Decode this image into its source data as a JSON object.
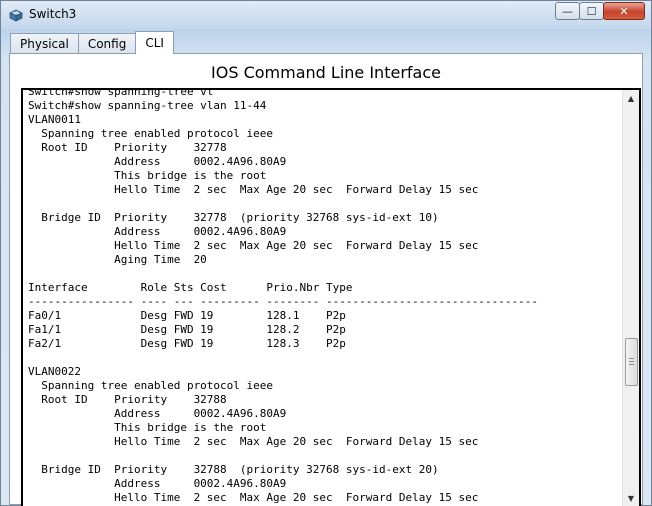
{
  "window": {
    "title": "Switch3",
    "app_icon": "cisco-switch-icon",
    "minimize_icon": "—",
    "maximize_icon": "☐",
    "close_icon": "✕"
  },
  "tabs": [
    {
      "label": "Physical",
      "active": false
    },
    {
      "label": "Config",
      "active": false
    },
    {
      "label": "CLI",
      "active": true
    }
  ],
  "cli": {
    "heading": "IOS Command Line Interface",
    "lines": [
      "Switch#show spanning-tree vl",
      "Switch#show spanning-tree vlan 11-44",
      "VLAN0011",
      "  Spanning tree enabled protocol ieee",
      "  Root ID    Priority    32778",
      "             Address     0002.4A96.80A9",
      "             This bridge is the root",
      "             Hello Time  2 sec  Max Age 20 sec  Forward Delay 15 sec",
      "",
      "  Bridge ID  Priority    32778  (priority 32768 sys-id-ext 10)",
      "             Address     0002.4A96.80A9",
      "             Hello Time  2 sec  Max Age 20 sec  Forward Delay 15 sec",
      "             Aging Time  20",
      "",
      "Interface        Role Sts Cost      Prio.Nbr Type",
      "---------------- ---- --- --------- -------- --------------------------------",
      "Fa0/1            Desg FWD 19        128.1    P2p",
      "Fa1/1            Desg FWD 19        128.2    P2p",
      "Fa2/1            Desg FWD 19        128.3    P2p",
      "",
      "VLAN0022",
      "  Spanning tree enabled protocol ieee",
      "  Root ID    Priority    32788",
      "             Address     0002.4A96.80A9",
      "             This bridge is the root",
      "             Hello Time  2 sec  Max Age 20 sec  Forward Delay 15 sec",
      "",
      "  Bridge ID  Priority    32788  (priority 32768 sys-id-ext 20)",
      "             Address     0002.4A96.80A9",
      "             Hello Time  2 sec  Max Age 20 sec  Forward Delay 15 sec"
    ]
  },
  "scrollbar": {
    "up_arrow": "▲",
    "down_arrow": "▼"
  }
}
